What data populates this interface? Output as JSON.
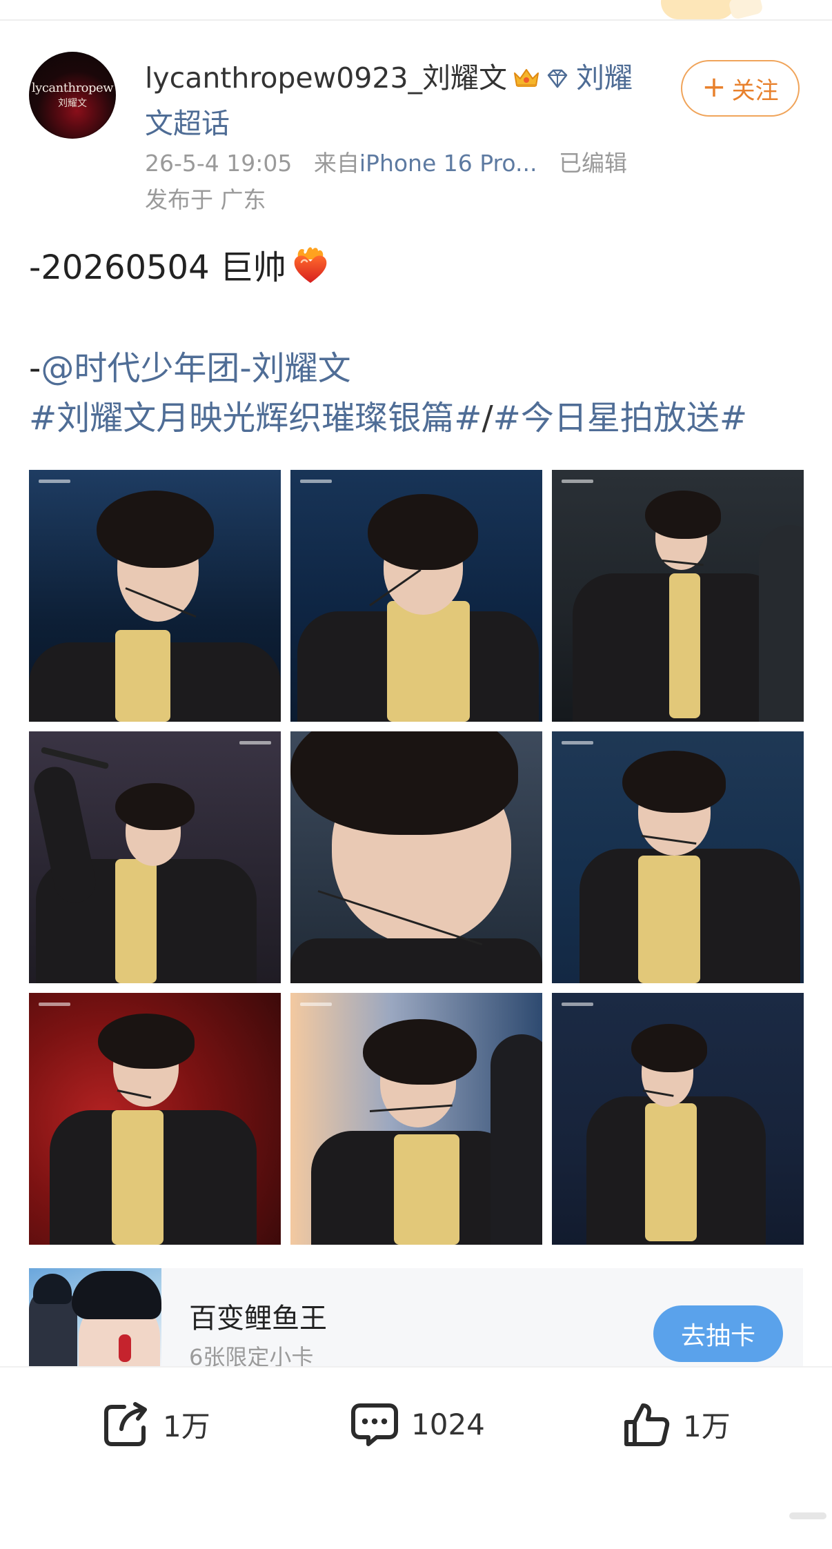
{
  "post": {
    "username": "lycanthropew0923_刘耀文",
    "topic": "刘耀文超话",
    "follow_label": "关注",
    "time": "26-5-4 19:05",
    "via": "来自",
    "device": "iPhone 16 Pro...",
    "edited": "已编辑",
    "location": "发布于 广东",
    "avatar_text_1": "lycanthropew",
    "avatar_text_2": "刘耀文",
    "line1": "-20260504 巨帅",
    "line2_prefix": "-",
    "mention": "@时代少年团-刘耀文",
    "hashtag1": "#刘耀文月映光辉织璀璨银篇#",
    "hashtag_separator": "/",
    "hashtag2": "#今日星拍放送#"
  },
  "gallery": {
    "photo_count": 9
  },
  "ad": {
    "title": "百变鲤鱼王",
    "subtitle": "6张限定小卡",
    "button": "去抽卡"
  },
  "actions": {
    "repost_count": "1万",
    "comment_count": "1024",
    "like_count": "1万"
  },
  "colors": {
    "link": "#4f6d96",
    "follow_orange": "#e8812d",
    "ad_button_blue": "#5aa2eb"
  },
  "icons": [
    "crown-icon",
    "diamond-icon",
    "heart-fire-emoji",
    "repost-icon",
    "comment-icon",
    "like-icon"
  ]
}
